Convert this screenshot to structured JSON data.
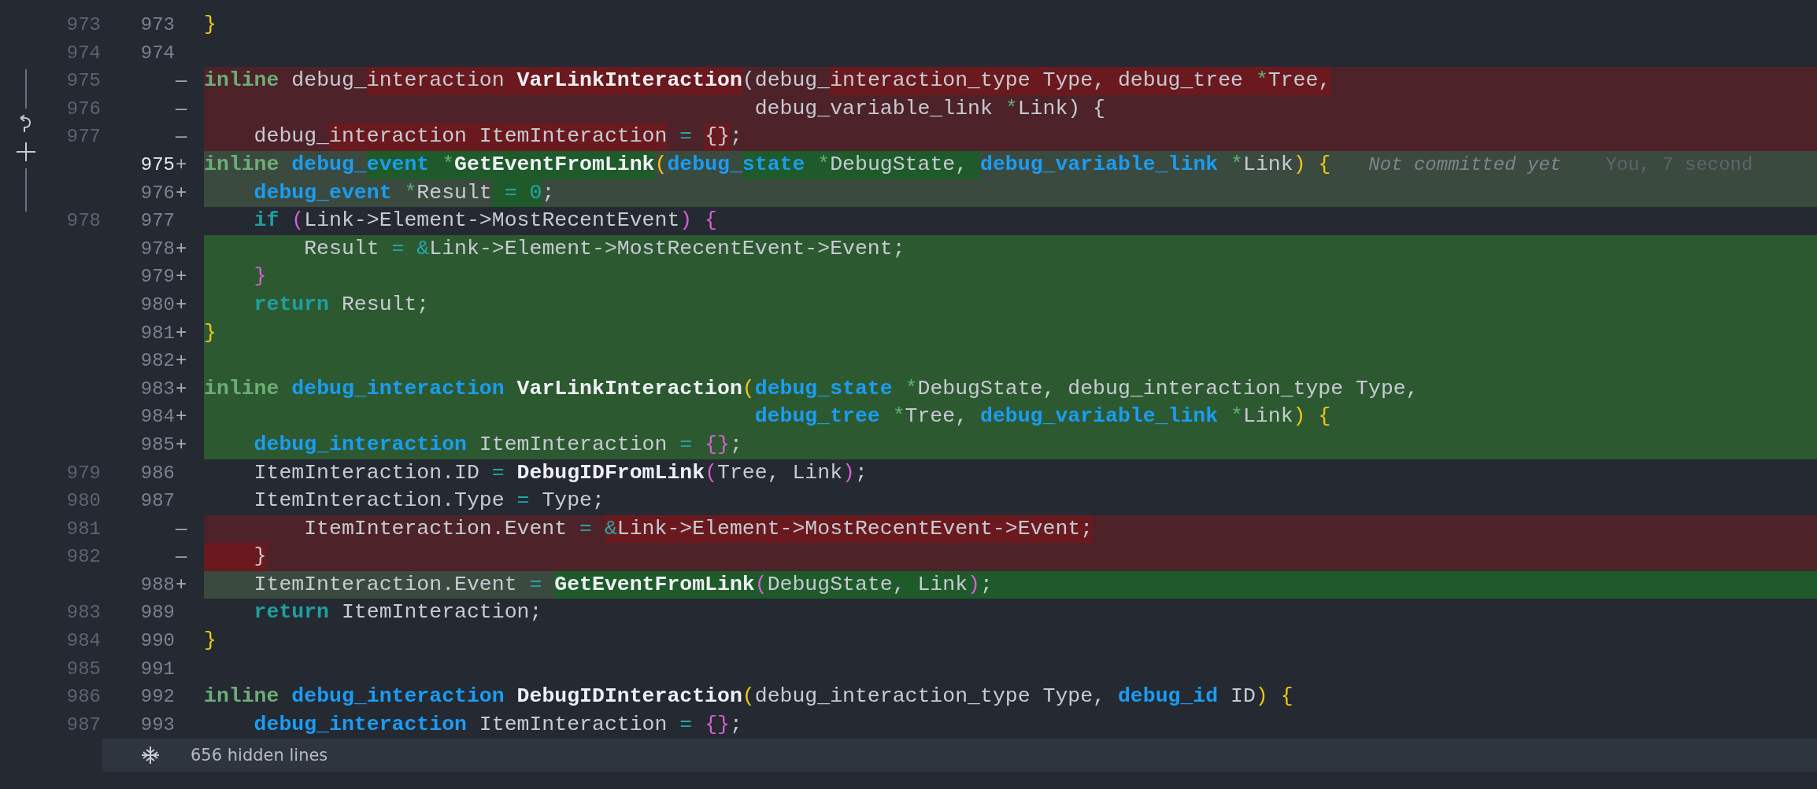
{
  "lines": [
    {
      "old": "973",
      "new": "973",
      "kind": "context",
      "current": false,
      "tokens": [
        {
          "text": "}",
          "kind": "bracket1",
          "changed": false
        }
      ]
    },
    {
      "old": "974",
      "new": "974",
      "kind": "context",
      "current": false
    },
    {
      "old": "975",
      "kind": "removed",
      "marker": "—",
      "current": false,
      "tokens": [
        {
          "text": "inline ",
          "kind": "keyword",
          "changed": false
        },
        {
          "text": "debug_",
          "kind": "ident",
          "changed": false
        },
        {
          "text": "interaction ",
          "kind": "ident",
          "changed": true
        },
        {
          "text": "VarLinkInteraction",
          "kind": "function",
          "changed": true
        },
        {
          "text": "(",
          "kind": "ident",
          "changed": false
        },
        {
          "text": "debug_",
          "kind": "ident",
          "changed": false
        },
        {
          "text": "interaction_type Type, debug_tree ",
          "kind": "ident",
          "changed": true
        },
        {
          "text": "*",
          "kind": "pointer",
          "changed": true
        },
        {
          "text": "Tree,",
          "kind": "ident",
          "changed": true
        }
      ]
    },
    {
      "old": "976",
      "kind": "removed",
      "marker": "—",
      "current": false,
      "tokens": [
        {
          "text": "                                            debug_variable_link ",
          "kind": "ident",
          "changed": false
        },
        {
          "text": "*",
          "kind": "pointer",
          "changed": false
        },
        {
          "text": "Link) {",
          "kind": "ident",
          "changed": false
        }
      ]
    },
    {
      "old": "977",
      "kind": "removed",
      "marker": "—",
      "current": false,
      "tokens": [
        {
          "text": "    debug_",
          "kind": "ident",
          "changed": false
        },
        {
          "text": "interaction ItemInteraction",
          "kind": "ident",
          "changed": true
        },
        {
          "text": " = ",
          "kind": "operator",
          "changed": false
        },
        {
          "text": "{}",
          "kind": "ident",
          "changed": true
        },
        {
          "text": ";",
          "kind": "ident",
          "changed": false
        }
      ]
    },
    {
      "new": "975",
      "kind": "modified",
      "marker": "+",
      "current": true,
      "tokens": [
        {
          "text": "inline ",
          "kind": "keyword",
          "changed": false
        },
        {
          "text": "debug_",
          "kind": "type",
          "changed": false
        },
        {
          "text": "event ",
          "kind": "type",
          "changed": true
        },
        {
          "text": "*",
          "kind": "pointer",
          "changed": true
        },
        {
          "text": "GetEventFromLink",
          "kind": "function",
          "changed": true
        },
        {
          "text": "(",
          "kind": "bracket1",
          "changed": false
        },
        {
          "text": "debug_",
          "kind": "type",
          "changed": false
        },
        {
          "text": "state ",
          "kind": "type",
          "changed": true
        },
        {
          "text": "*",
          "kind": "pointer",
          "changed": true
        },
        {
          "text": "DebugState, ",
          "kind": "ident",
          "changed": true
        },
        {
          "text": "debug_variable_link ",
          "kind": "type",
          "changed": false
        },
        {
          "text": "*",
          "kind": "pointer",
          "changed": false
        },
        {
          "text": "Link",
          "kind": "ident",
          "changed": false
        },
        {
          "text": ") {",
          "kind": "bracket1",
          "changed": false
        }
      ],
      "blame": {
        "message": "Not committed yet",
        "author": "You, 7 second"
      }
    },
    {
      "new": "976",
      "kind": "modified",
      "marker": "+",
      "current": false,
      "tokens": [
        {
          "text": "    debug_event ",
          "kind": "type",
          "changed": false
        },
        {
          "text": "*",
          "kind": "pointer",
          "changed": false
        },
        {
          "text": "Result",
          "kind": "ident",
          "changed": false
        },
        {
          "text": " = ",
          "kind": "operator",
          "changed": true
        },
        {
          "text": "0",
          "kind": "operator",
          "changed": true
        },
        {
          "text": ";",
          "kind": "ident",
          "changed": false
        }
      ]
    },
    {
      "old": "978",
      "new": "977",
      "kind": "context",
      "current": false,
      "tokens": [
        {
          "text": "    if ",
          "kind": "control",
          "changed": false
        },
        {
          "text": "(",
          "kind": "bracket2",
          "changed": false
        },
        {
          "text": "Link->Element->MostRecentEvent",
          "kind": "ident",
          "changed": false
        },
        {
          "text": ") {",
          "kind": "bracket2",
          "changed": false
        }
      ]
    },
    {
      "new": "978",
      "kind": "added",
      "marker": "+",
      "current": false,
      "tokens": [
        {
          "text": "        Result ",
          "kind": "ident",
          "changed": false
        },
        {
          "text": "= &",
          "kind": "operator",
          "changed": false
        },
        {
          "text": "Link->Element->MostRecentEvent->Event;",
          "kind": "ident",
          "changed": false
        }
      ]
    },
    {
      "new": "979",
      "kind": "added",
      "marker": "+",
      "current": false,
      "tokens": [
        {
          "text": "    }",
          "kind": "bracket2",
          "changed": false
        }
      ]
    },
    {
      "new": "980",
      "kind": "added",
      "marker": "+",
      "current": false,
      "tokens": [
        {
          "text": "    return ",
          "kind": "control",
          "changed": false
        },
        {
          "text": "Result;",
          "kind": "ident",
          "changed": false
        }
      ]
    },
    {
      "new": "981",
      "kind": "added",
      "marker": "+",
      "current": false,
      "tokens": [
        {
          "text": "}",
          "kind": "bracket1",
          "changed": false
        }
      ]
    },
    {
      "new": "982",
      "kind": "added",
      "marker": "+",
      "current": false
    },
    {
      "new": "983",
      "kind": "added",
      "marker": "+",
      "current": false,
      "tokens": [
        {
          "text": "inline ",
          "kind": "keyword",
          "changed": false
        },
        {
          "text": "debug_interaction ",
          "kind": "type",
          "changed": false
        },
        {
          "text": "VarLinkInteraction",
          "kind": "function",
          "changed": false
        },
        {
          "text": "(",
          "kind": "bracket1",
          "changed": false
        },
        {
          "text": "debug_state ",
          "kind": "type",
          "changed": false
        },
        {
          "text": "*",
          "kind": "pointer",
          "changed": false
        },
        {
          "text": "DebugState, debug_interaction_type Type,",
          "kind": "ident",
          "changed": false
        }
      ]
    },
    {
      "new": "984",
      "kind": "added",
      "marker": "+",
      "current": false,
      "tokens": [
        {
          "text": "                                            debug_tree ",
          "kind": "type",
          "changed": false
        },
        {
          "text": "*",
          "kind": "pointer",
          "changed": false
        },
        {
          "text": "Tree, ",
          "kind": "ident",
          "changed": false
        },
        {
          "text": "debug_variable_link ",
          "kind": "type",
          "changed": false
        },
        {
          "text": "*",
          "kind": "pointer",
          "changed": false
        },
        {
          "text": "Link",
          "kind": "ident",
          "changed": false
        },
        {
          "text": ") {",
          "kind": "bracket1",
          "changed": false
        }
      ]
    },
    {
      "new": "985",
      "kind": "added",
      "marker": "+",
      "current": false,
      "tokens": [
        {
          "text": "    debug_interaction ",
          "kind": "type",
          "changed": false
        },
        {
          "text": "ItemInteraction ",
          "kind": "ident",
          "changed": false
        },
        {
          "text": "= ",
          "kind": "operator",
          "changed": false
        },
        {
          "text": "{}",
          "kind": "bracket2",
          "changed": false
        },
        {
          "text": ";",
          "kind": "ident",
          "changed": false
        }
      ]
    },
    {
      "old": "979",
      "new": "986",
      "kind": "context",
      "current": false,
      "tokens": [
        {
          "text": "    ItemInteraction.ID ",
          "kind": "ident",
          "changed": false
        },
        {
          "text": "= ",
          "kind": "operator",
          "changed": false
        },
        {
          "text": "DebugIDFromLink",
          "kind": "function",
          "changed": false
        },
        {
          "text": "(",
          "kind": "bracket2",
          "changed": false
        },
        {
          "text": "Tree, Link",
          "kind": "ident",
          "changed": false
        },
        {
          "text": ")",
          "kind": "bracket2",
          "changed": false
        },
        {
          "text": ";",
          "kind": "ident",
          "changed": false
        }
      ]
    },
    {
      "old": "980",
      "new": "987",
      "kind": "context",
      "current": false,
      "tokens": [
        {
          "text": "    ItemInteraction.Type ",
          "kind": "ident",
          "changed": false
        },
        {
          "text": "= ",
          "kind": "operator",
          "changed": false
        },
        {
          "text": "Type;",
          "kind": "ident",
          "changed": false
        }
      ]
    },
    {
      "old": "981",
      "kind": "removed",
      "marker": "—",
      "current": false,
      "tokens": [
        {
          "text": "        ItemInteraction.Event ",
          "kind": "ident",
          "changed": false
        },
        {
          "text": "= ",
          "kind": "operator",
          "changed": false
        },
        {
          "text": "&",
          "kind": "operator",
          "changed": true
        },
        {
          "text": "Link->Element->MostRecentEvent->Event;",
          "kind": "ident",
          "changed": true
        }
      ]
    },
    {
      "old": "982",
      "kind": "removed",
      "marker": "—",
      "current": false,
      "tokens": [
        {
          "text": "    }",
          "kind": "ident",
          "changed": true
        }
      ]
    },
    {
      "new": "988",
      "kind": "modified",
      "marker": "+",
      "current": false,
      "tokens": [
        {
          "text": "    ItemInteraction.Event ",
          "kind": "ident",
          "changed": false
        },
        {
          "text": "= ",
          "kind": "operator",
          "changed": false
        },
        {
          "text": "GetEventFromLink",
          "kind": "function",
          "changed": true
        },
        {
          "text": "(",
          "kind": "bracket2",
          "changed": true
        },
        {
          "text": "DebugState, Link",
          "kind": "ident",
          "changed": true
        },
        {
          "text": ")",
          "kind": "bracket2",
          "changed": true
        },
        {
          "text": ";",
          "kind": "ident",
          "changed": true
        }
      ]
    },
    {
      "old": "983",
      "new": "989",
      "kind": "context",
      "current": false,
      "tokens": [
        {
          "text": "    return ",
          "kind": "control",
          "changed": false
        },
        {
          "text": "ItemInteraction;",
          "kind": "ident",
          "changed": false
        }
      ]
    },
    {
      "old": "984",
      "new": "990",
      "kind": "context",
      "current": false,
      "tokens": [
        {
          "text": "}",
          "kind": "bracket1",
          "changed": false
        }
      ]
    },
    {
      "old": "985",
      "new": "991",
      "kind": "context",
      "current": false
    },
    {
      "old": "986",
      "new": "992",
      "kind": "context",
      "current": false,
      "tokens": [
        {
          "text": "inline ",
          "kind": "keyword",
          "changed": false
        },
        {
          "text": "debug_interaction ",
          "kind": "type",
          "changed": false
        },
        {
          "text": "DebugIDInteraction",
          "kind": "function",
          "changed": false
        },
        {
          "text": "(",
          "kind": "bracket1",
          "changed": false
        },
        {
          "text": "debug_interaction_type Type, ",
          "kind": "ident",
          "changed": false
        },
        {
          "text": "debug_id ",
          "kind": "type",
          "changed": false
        },
        {
          "text": "ID",
          "kind": "ident",
          "changed": false
        },
        {
          "text": ") {",
          "kind": "bracket1",
          "changed": false
        }
      ]
    },
    {
      "old": "987",
      "new": "993",
      "kind": "context",
      "current": false,
      "tokens": [
        {
          "text": "    debug_interaction ",
          "kind": "type",
          "changed": false
        },
        {
          "text": "ItemInteraction ",
          "kind": "ident",
          "changed": false
        },
        {
          "text": "= ",
          "kind": "operator",
          "changed": false
        },
        {
          "text": "{}",
          "kind": "bracket2",
          "changed": false
        },
        {
          "text": ";",
          "kind": "ident",
          "changed": false
        }
      ]
    }
  ],
  "hidden_lines": {
    "label": "656 hidden lines"
  }
}
